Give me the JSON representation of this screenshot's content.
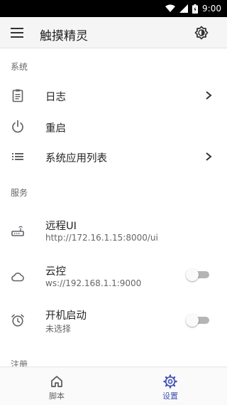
{
  "status_bar": {
    "time": "9:00"
  },
  "app_bar": {
    "title": "触摸精灵"
  },
  "sections": {
    "system": {
      "header": "系统",
      "log": "日志",
      "restart": "重启",
      "app_list": "系统应用列表"
    },
    "services": {
      "header": "服务",
      "remote_ui": {
        "title": "远程UI",
        "subtitle": "http://172.16.1.15:8000/ui"
      },
      "cloud": {
        "title": "云控",
        "subtitle": "ws://192.168.1.1:9000",
        "enabled": false
      },
      "autostart": {
        "title": "开机启动",
        "subtitle": "未选择",
        "enabled": false
      }
    },
    "register": {
      "header": "注册"
    }
  },
  "bottom_nav": {
    "items": [
      {
        "label": "脚本",
        "active": false
      },
      {
        "label": "设置",
        "active": true
      }
    ]
  },
  "colors": {
    "accent": "#3f51b5",
    "icon_gray": "#5f6368",
    "inactive_nav": "#666666"
  }
}
